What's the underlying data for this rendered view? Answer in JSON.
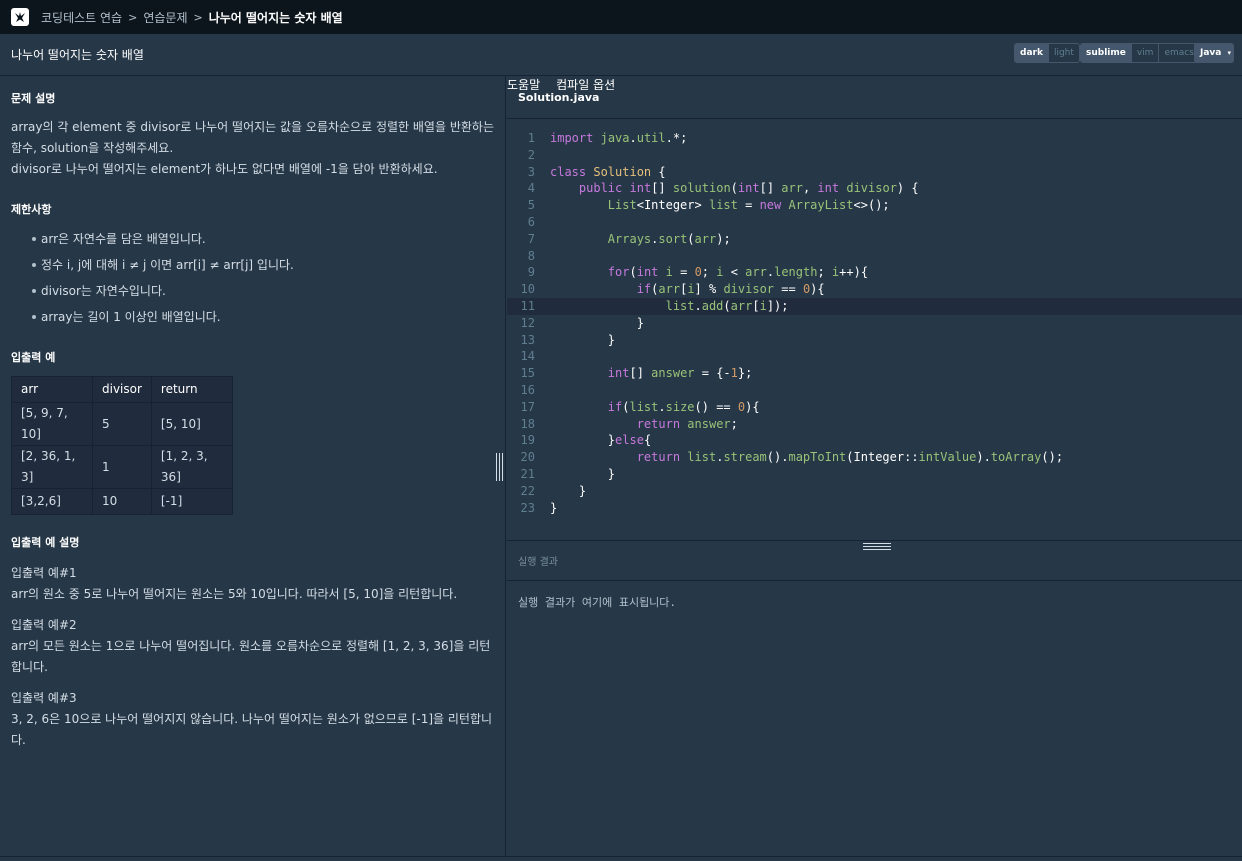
{
  "nav": {
    "breadcrumb": [
      "코딩테스트 연습",
      "연습문제",
      "나누어 떨어지는 숫자 배열"
    ],
    "help": "도움말",
    "compiler_options": "컴파일 옵션"
  },
  "title": "나누어 떨어지는 숫자 배열",
  "toolbar": {
    "theme": [
      "dark",
      "light"
    ],
    "editor_mode": [
      "sublime",
      "vim",
      "emacs"
    ],
    "language": "Java"
  },
  "problem": {
    "desc_heading": "문제 설명",
    "desc_line1": "array의 각 element 중 divisor로 나누어 떨어지는 값을 오름차순으로 정렬한 배열을 반환하는 함수, solution을 작성해주세요.",
    "desc_line2": "divisor로 나누어 떨어지는 element가 하나도 없다면 배열에 -1을 담아 반환하세요.",
    "constraints_heading": "제한사항",
    "constraints": [
      "arr은 자연수를 담은 배열입니다.",
      "정수 i, j에 대해 i ≠ j 이면 arr[i] ≠ arr[j] 입니다.",
      "divisor는 자연수입니다.",
      "array는 길이 1 이상인 배열입니다."
    ],
    "io_heading": "입출력 예",
    "io_headers": [
      "arr",
      "divisor",
      "return"
    ],
    "io_rows": [
      [
        "[5, 9, 7, 10]",
        "5",
        "[5, 10]"
      ],
      [
        "[2, 36, 1, 3]",
        "1",
        "[1, 2, 3, 36]"
      ],
      [
        "[3,2,6]",
        "10",
        "[-1]"
      ]
    ],
    "io_desc_heading": "입출력 예 설명",
    "examples": [
      {
        "title": "입출력 예#1",
        "text": "arr의 원소 중 5로 나누어 떨어지는 원소는 5와 10입니다. 따라서 [5, 10]을 리턴합니다."
      },
      {
        "title": "입출력 예#2",
        "text": "arr의 모든 원소는 1으로 나누어 떨어집니다. 원소를 오름차순으로 정렬해 [1, 2, 3, 36]을 리턴합니다."
      },
      {
        "title": "입출력 예#3",
        "text": "3, 2, 6은 10으로 나누어 떨어지지 않습니다. 나누어 떨어지는 원소가 없으므로 [-1]을 리턴합니다."
      }
    ]
  },
  "editor": {
    "filename": "Solution.java",
    "active_line": 11,
    "lines": [
      "import java.util.*;",
      "",
      "class Solution {",
      "    public int[] solution(int[] arr, int divisor) {",
      "        List<Integer> list = new ArrayList<>();",
      "",
      "        Arrays.sort(arr);",
      "",
      "        for(int i = 0; i < arr.length; i++){",
      "            if(arr[i] % divisor == 0){",
      "                list.add(arr[i]);",
      "            }",
      "        }",
      "",
      "        int[] answer = {-1};",
      "",
      "        if(list.size() == 0){",
      "            return answer;",
      "        }else{",
      "            return list.stream().mapToInt(Integer::intValue).toArray();",
      "        }",
      "    }",
      "}"
    ]
  },
  "result": {
    "label": "실행 결과",
    "placeholder": "실행 결과가 여기에 표시됩니다."
  }
}
